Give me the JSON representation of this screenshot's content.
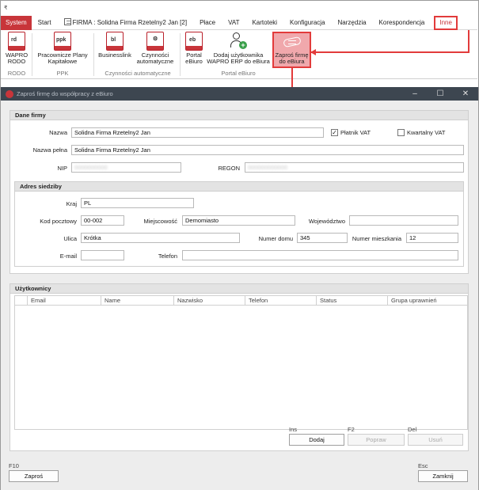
{
  "menu": {
    "tabs": [
      "System",
      "Start",
      "FIRMA : Solidna Firma Rzetelny2 Jan [2]",
      "Płace",
      "VAT",
      "Kartoteki",
      "Konfiguracja",
      "Narzędzia",
      "Korespondencja",
      "Inne"
    ]
  },
  "ribbon": {
    "buttons": [
      {
        "icon": "rd",
        "label1": "WAPRO",
        "label2": "RODO"
      },
      {
        "icon": "ppk",
        "label1": "Pracownicze Plany",
        "label2": "Kapitałowe"
      },
      {
        "icon": "bl",
        "label1": "Businesslink",
        "label2": ""
      },
      {
        "icon": "gear",
        "label1": "Czynności",
        "label2": "automatyczne"
      },
      {
        "icon": "eb",
        "label1": "Portal",
        "label2": "eBiuro"
      },
      {
        "icon": "add-user",
        "label1": "Dodaj użytkownika",
        "label2": "WAPRO ERP do eBiura"
      },
      {
        "icon": "handshake",
        "label1": "Zaproś firmę",
        "label2": "do eBiura"
      }
    ],
    "groups": [
      "RODO",
      "PPK",
      "Czynności automatyczne",
      "Portal eBiuro"
    ]
  },
  "window": {
    "title": "Zaproś firmę do współpracy z eBiuro",
    "controls": [
      "–",
      "☐",
      "✕"
    ]
  },
  "dane": {
    "title": "Dane firmy",
    "nazwa_label": "Nazwa",
    "nazwa_value": "Solidna Firma Rzetelny2 Jan",
    "platnik_label": "Płatnik VAT",
    "platnik_checked": "✓",
    "kwartalny_label": "Kwartalny VAT",
    "pelna_label": "Nazwa pełna",
    "pelna_value": "Solidna Firma Rzetelny2 Jan",
    "nip_label": "NIP",
    "nip_value": "0000000000",
    "regon_label": "REGON",
    "regon_value": "000000000000"
  },
  "adres": {
    "title": "Adres siedziby",
    "kraj_label": "Kraj",
    "kraj_value": "PL",
    "kod_label": "Kod pocztowy",
    "kod_value": "00-002",
    "miejsc_label": "Miejscowość",
    "miejsc_value": "Demomiasto",
    "woj_label": "Województwo",
    "woj_value": "",
    "ulica_label": "Ulica",
    "ulica_value": "Krótka",
    "nrdomu_label": "Numer domu",
    "nrdomu_value": "345",
    "nrmiesz_label": "Numer mieszkania",
    "nrmiesz_value": "12",
    "email_label": "E-mail",
    "email_value": "",
    "tel_label": "Telefon",
    "tel_value": ""
  },
  "users": {
    "title": "Użytkownicy",
    "columns": [
      "Email",
      "Name",
      "Nazwisko",
      "Telefon",
      "Status",
      "Grupa uprawnień"
    ]
  },
  "actions": {
    "ins_key": "Ins",
    "dodaj": "Dodaj",
    "f2_key": "F2",
    "popraw": "Popraw",
    "del_key": "Del",
    "usun": "Usuń",
    "f10_key": "F10",
    "zapros": "Zaproś",
    "esc_key": "Esc",
    "zamknij": "Zamknij"
  },
  "colors": {
    "brand": "#c8353a",
    "highlight": "#e23b3b"
  }
}
